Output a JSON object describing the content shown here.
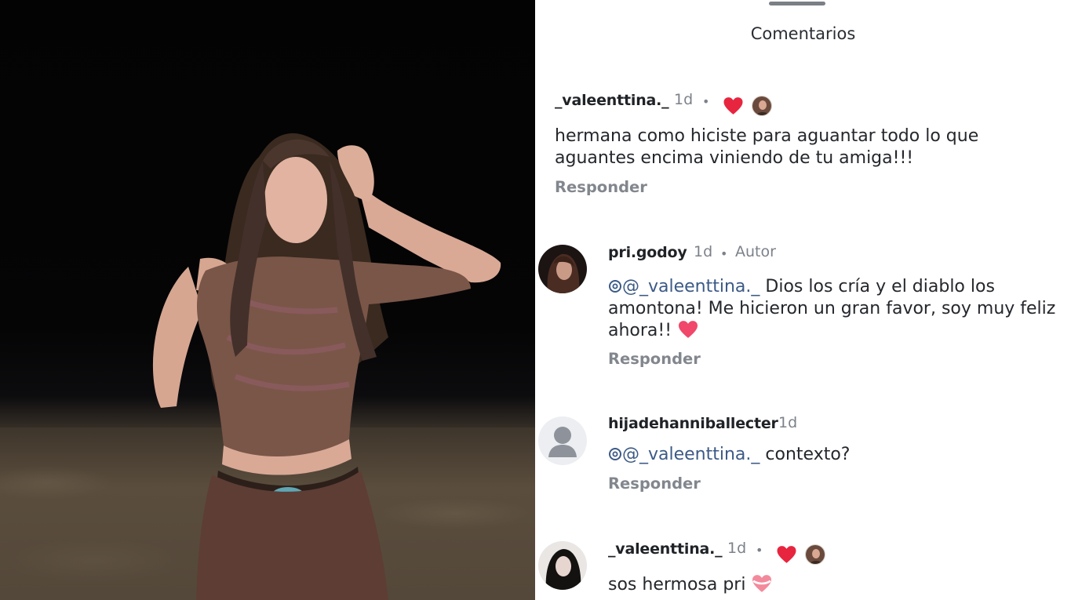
{
  "header": {
    "title": "Comentarios"
  },
  "comments": [
    {
      "username": "_valeenttina._",
      "time": "1d",
      "text": "hermana como hiciste para aguantar todo lo que aguantes encima viniendo de tu amiga!!!",
      "reply_label": "Responder",
      "liked_by_author": true
    },
    {
      "username": "pri.godoy",
      "time": "1d",
      "badge": "Autor",
      "mention": "@_valeenttina._",
      "text": "Dios los cría y el diablo los amontona! Me hicieron un gran favor, soy muy feliz ahora!!",
      "reply_label": "Responder"
    },
    {
      "username": "hijadehanniballecter",
      "time": "1d",
      "mention": "@_valeenttina._",
      "text": "contexto?",
      "reply_label": "Responder"
    },
    {
      "username": "_valeenttina._",
      "time": "1d",
      "text": "sos hermosa pri",
      "liked_by_author": true
    }
  ],
  "icons": {
    "heart": "heart-icon",
    "author_avatar": "author-avatar",
    "default_avatar": "default-avatar-icon",
    "threads_mention": "threads-at-icon"
  },
  "colors": {
    "heart": "#e8253f",
    "mention": "#3c5a86",
    "muted": "#7c818a"
  }
}
